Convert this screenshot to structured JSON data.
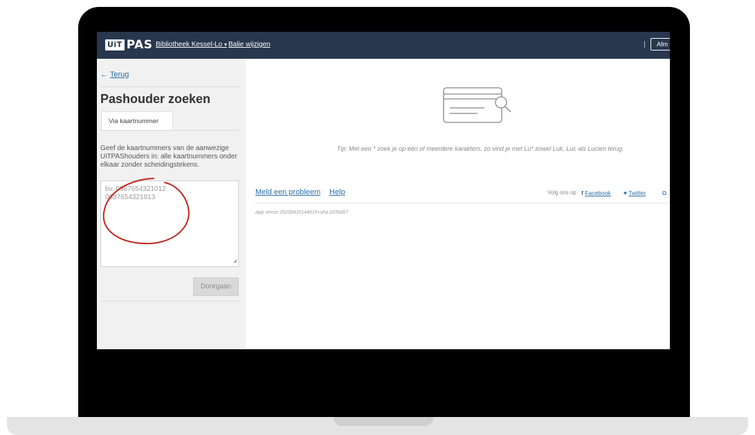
{
  "header": {
    "logo_box": "UiT",
    "logo_text": "PAS",
    "location": "Bibliotheek Kessel-Lo",
    "location_caret": "▾",
    "change_counter": "Balie wijzigen",
    "logout_label": "Afm"
  },
  "sidebar": {
    "back_arrow": "←",
    "back_label": "Terug",
    "title": "Pashouder zoeken",
    "tab_label": "Via kaartnummer",
    "instructions": "Geef de kaartnummers van de aanwezige UiTPAShouders in: alle kaartnummers onder elkaar zonder scheidingstekens.",
    "card_numbers": [
      "bv. 0987654321012",
      "0987654321013"
    ],
    "continue_label": "Doorgaan"
  },
  "main": {
    "icon": "search-card-icon",
    "tip": "Tip: Met een * zoek je op één of meerdere karakters, zo vind je met Lu* zowel Luk, Luc als Lucien terug."
  },
  "footer": {
    "report_label": "Meld een probleem",
    "help_label": "Help",
    "follow_label": "Volg ons op",
    "facebook_label": "Facebook",
    "twitter_label": "Twitter",
    "version": "App versie 20200420144615+sha.d335d67"
  },
  "colors": {
    "topbar": "#28374d",
    "link": "#2a6ea8",
    "annotation": "#c0271d"
  }
}
